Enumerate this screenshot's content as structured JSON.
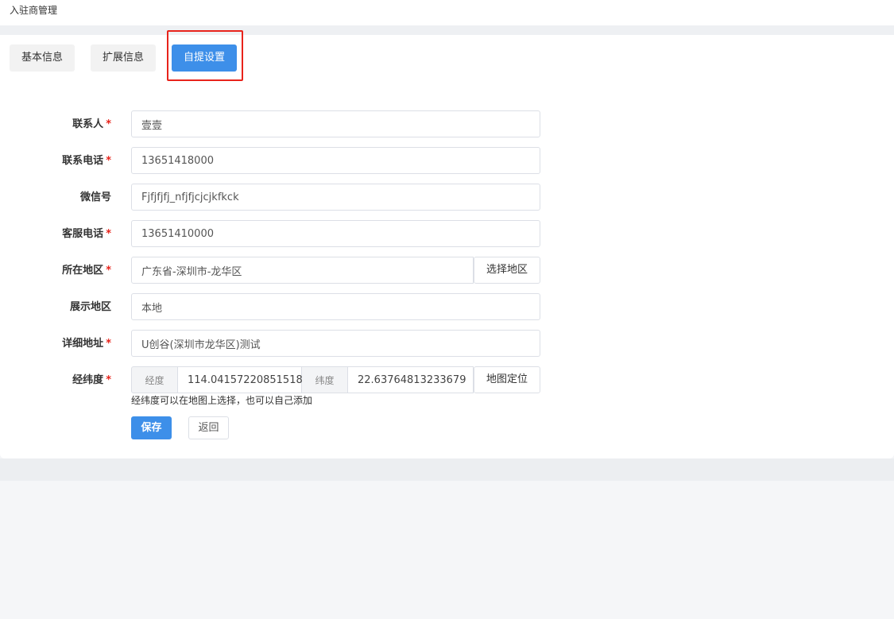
{
  "breadcrumb": "入驻商管理",
  "tabs": [
    {
      "label": "基本信息"
    },
    {
      "label": "扩展信息"
    },
    {
      "label": "自提设置"
    }
  ],
  "form": {
    "contact": {
      "label": "联系人",
      "required_mark": "*",
      "value": "壹壹"
    },
    "phone": {
      "label": "联系电话",
      "required_mark": "*",
      "value": "13651418000"
    },
    "wechat": {
      "label": "微信号",
      "value": "Fjfjfjfj_nfjfjcjcjkfkck"
    },
    "service_phone": {
      "label": "客服电话",
      "required_mark": "*",
      "value": "13651410000"
    },
    "region": {
      "label": "所在地区",
      "required_mark": "*",
      "value": "广东省-深圳市-龙华区",
      "button": "选择地区"
    },
    "display_region": {
      "label": "展示地区",
      "value": "本地"
    },
    "address": {
      "label": "详细地址",
      "required_mark": "*",
      "value": "U创谷(深圳市龙华区)测试"
    },
    "coords": {
      "label": "经纬度",
      "required_mark": "*",
      "lng_prefix": "经度",
      "lng_value": "114.04157220851518",
      "lat_prefix": "纬度",
      "lat_value": "22.63764813233679",
      "button": "地图定位",
      "hint": "经纬度可以在地图上选择，也可以自己添加"
    }
  },
  "actions": {
    "save": "保存",
    "back": "返回"
  },
  "colors": {
    "primary": "#3d8fe9",
    "required": "#e8231b",
    "highlight_border": "#e8231b"
  }
}
